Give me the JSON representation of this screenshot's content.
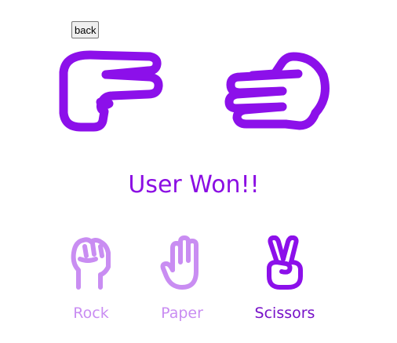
{
  "back_label": "back",
  "user_hand": {
    "icon": "scissors-hand-icon",
    "color": "#8c10ea"
  },
  "computer_hand": {
    "icon": "paper-hand-icon",
    "color": "#8c10ea"
  },
  "result_text": "User Won!!",
  "choices": [
    {
      "label": "Rock",
      "icon": "rock-hand-icon",
      "selected": false
    },
    {
      "label": "Paper",
      "icon": "paper-hand-icon",
      "selected": false
    },
    {
      "label": "Scissors",
      "icon": "scissors-hand-icon",
      "selected": true
    }
  ],
  "colors": {
    "primary": "#8c10ea",
    "inactive": "#c98df2",
    "selected_label": "#7711c8"
  }
}
